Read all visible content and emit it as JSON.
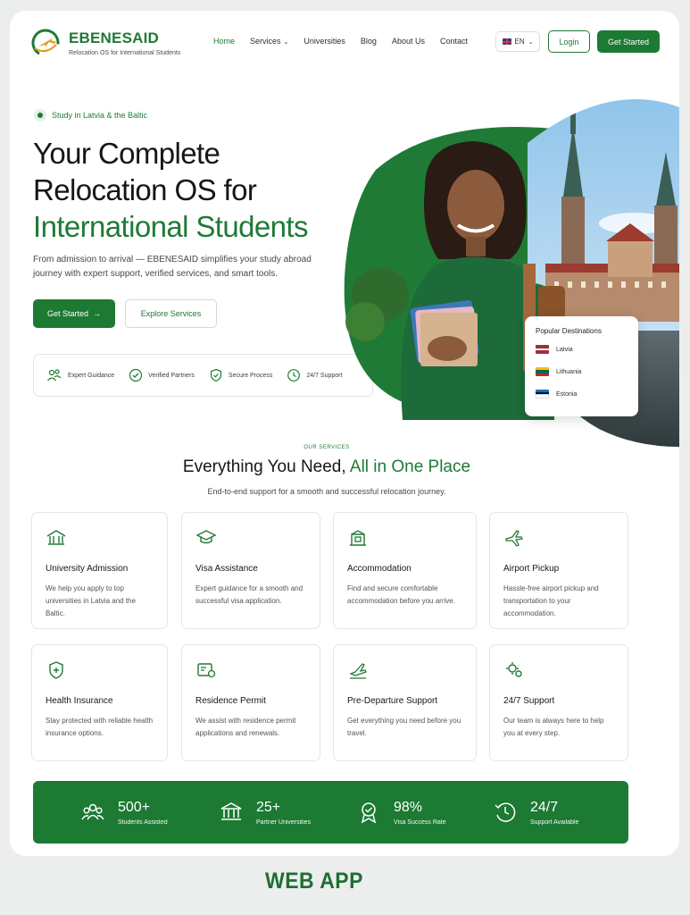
{
  "brand": {
    "name": "EBENESAID",
    "tagline": "Relocation OS for International Students"
  },
  "nav": {
    "items": [
      {
        "label": "Home",
        "active": true
      },
      {
        "label": "Services",
        "dropdown": true
      },
      {
        "label": "Universities"
      },
      {
        "label": "Blog"
      },
      {
        "label": "About Us"
      },
      {
        "label": "Contact"
      }
    ],
    "language": "EN",
    "login_label": "Login",
    "cta_label": "Get Started"
  },
  "hero": {
    "pill": "Study in Latvia & the Baltic",
    "title_line1": "Your Complete",
    "title_line2": "Relocation OS for",
    "title_line3": "International Students",
    "subtitle": "From admission to arrival — EBENESAID simplifies your study abroad journey with expert support, verified services, and smart tools.",
    "primary_button": "Get Started",
    "secondary_button": "Explore Services",
    "features": [
      {
        "label": "Expert Guidance",
        "icon": "people-icon"
      },
      {
        "label": "Verified Partners",
        "icon": "check-circle-icon"
      },
      {
        "label": "Secure Process",
        "icon": "shield-check-icon"
      },
      {
        "label": "24/7 Support",
        "icon": "clock-icon"
      }
    ],
    "destinations": {
      "title": "Popular Destinations",
      "items": [
        "Latvia",
        "Lithuania",
        "Estonia"
      ]
    }
  },
  "services": {
    "kicker": "OUR SERVICES",
    "title_part1": "Everything You Need, ",
    "title_part2": "All in One Place",
    "subtitle": "End-to-end support for a smooth and successful relocation journey.",
    "items": [
      {
        "title": "University Admission",
        "desc": "We help you apply to top universities in Latvia and the Baltic.",
        "icon": "university-icon"
      },
      {
        "title": "Visa Assistance",
        "desc": "Expert guidance for a smooth and successful visa application.",
        "icon": "graduation-cap-icon"
      },
      {
        "title": "Accommodation",
        "desc": "Find and secure comfortable accommodation before you arrive.",
        "icon": "building-icon"
      },
      {
        "title": "Airport Pickup",
        "desc": "Hassle-free airport pickup and transportation to your accommodation.",
        "icon": "plane-icon"
      },
      {
        "title": "Health Insurance",
        "desc": "Stay protected with reliable health insurance options.",
        "icon": "health-shield-icon"
      },
      {
        "title": "Residence Permit",
        "desc": "We assist with residence permit applications and renewals.",
        "icon": "id-card-icon"
      },
      {
        "title": "Pre-Departure Support",
        "desc": "Get everything you need before you travel.",
        "icon": "plane-takeoff-icon"
      },
      {
        "title": "24/7 Support",
        "desc": "Our team is always here to help you at every step.",
        "icon": "support-gears-icon"
      }
    ]
  },
  "stats": [
    {
      "value": "500+",
      "label": "Students Assisted",
      "icon": "users-icon"
    },
    {
      "value": "25+",
      "label": "Partner Universities",
      "icon": "institution-icon"
    },
    {
      "value": "98%",
      "label": "Visa Success Rate",
      "icon": "award-icon"
    },
    {
      "value": "24/7",
      "label": "Support Available",
      "icon": "clock-icon"
    }
  ],
  "footer_label": "WEB APP",
  "colors": {
    "brand_green": "#1c7a33",
    "accent_green_light": "#e2f1e5",
    "background": "#eceeed"
  }
}
